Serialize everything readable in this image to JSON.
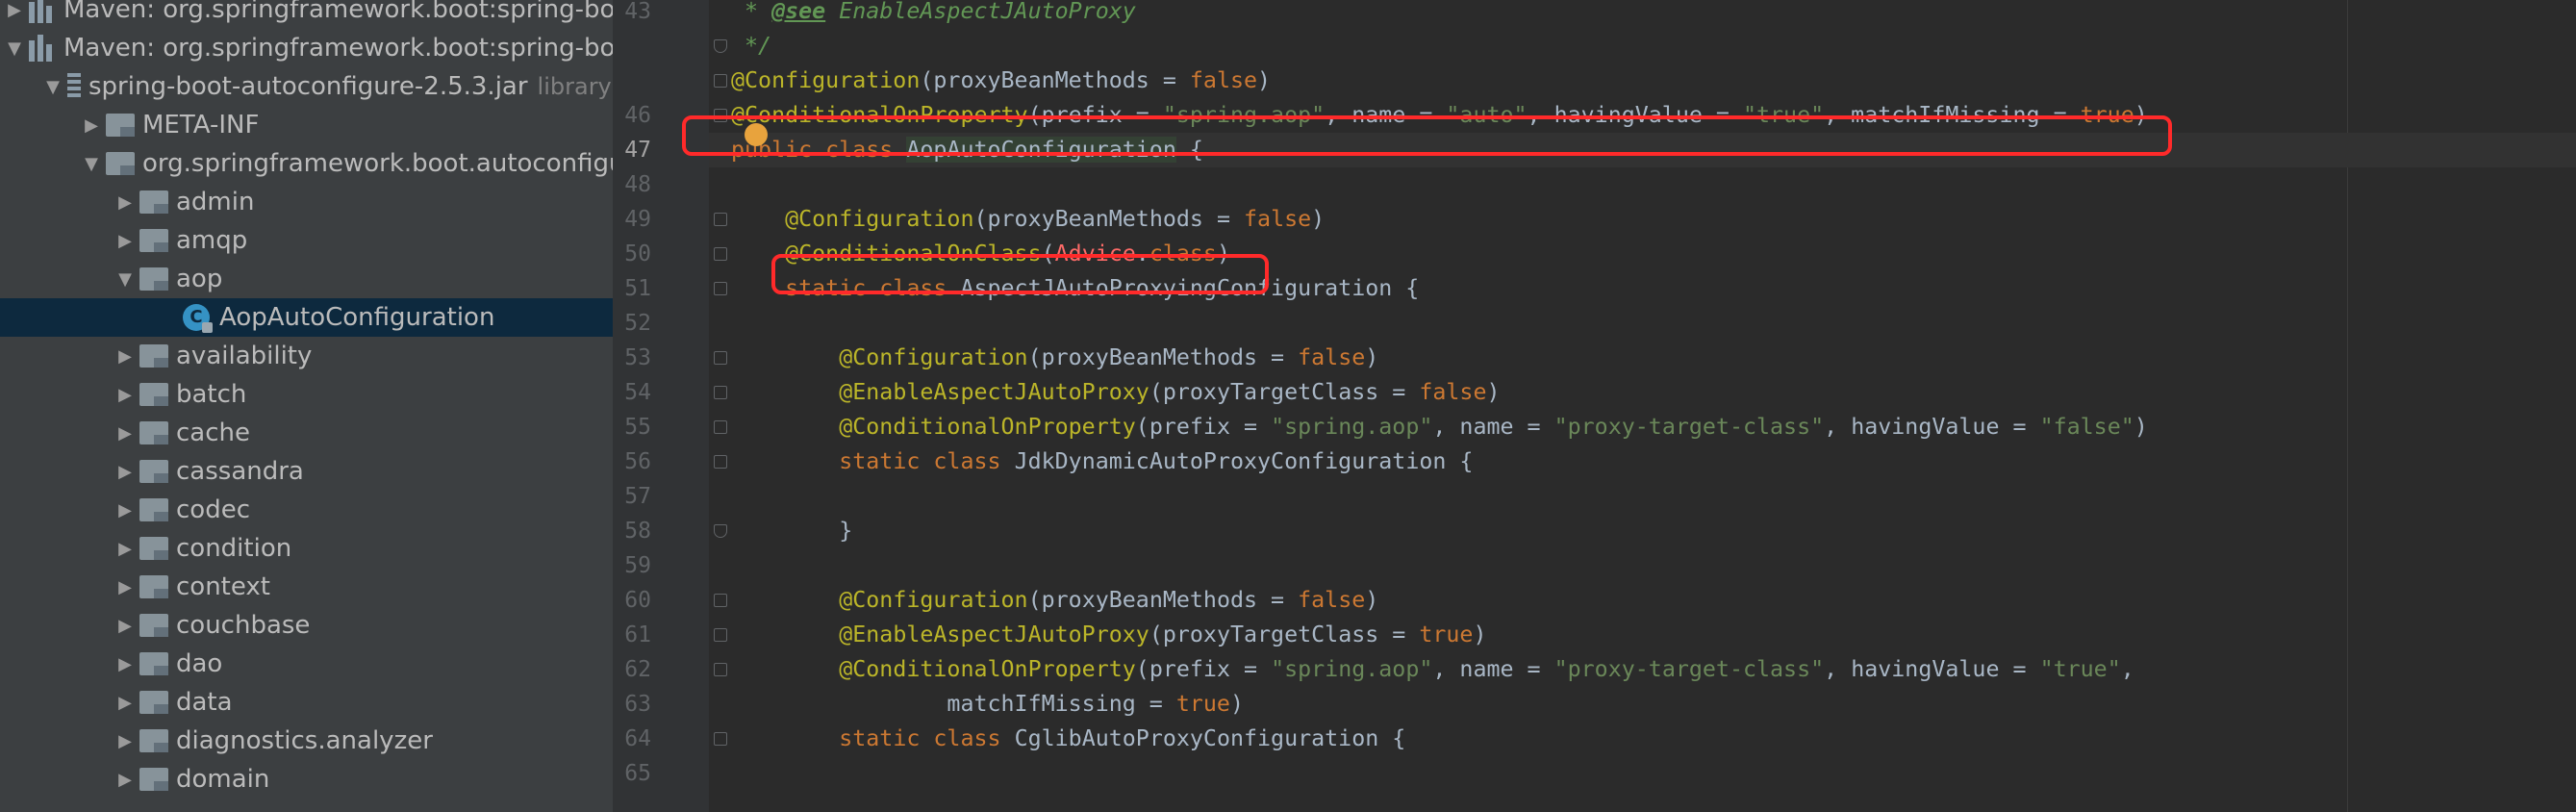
{
  "tree": {
    "rows": [
      {
        "label": "Maven: org.springframework.boot:spring-bo",
        "tag": "",
        "arrow": "▶"
      },
      {
        "label": "Maven: org.springframework.boot:spring-bo",
        "tag": "",
        "arrow": "▼"
      },
      {
        "label": "spring-boot-autoconfigure-2.5.3.jar",
        "tag": "library root",
        "arrow": "▼"
      },
      {
        "label": "META-INF",
        "tag": "",
        "arrow": "▶"
      },
      {
        "label": "org.springframework.boot.autoconfigu",
        "tag": "",
        "arrow": "▼"
      },
      {
        "label": "admin",
        "tag": "",
        "arrow": "▶"
      },
      {
        "label": "amqp",
        "tag": "",
        "arrow": "▶"
      },
      {
        "label": "aop",
        "tag": "",
        "arrow": "▼"
      },
      {
        "label": "AopAutoConfiguration",
        "tag": "",
        "arrow": ""
      },
      {
        "label": "availability",
        "tag": "",
        "arrow": "▶"
      },
      {
        "label": "batch",
        "tag": "",
        "arrow": "▶"
      },
      {
        "label": "cache",
        "tag": "",
        "arrow": "▶"
      },
      {
        "label": "cassandra",
        "tag": "",
        "arrow": "▶"
      },
      {
        "label": "codec",
        "tag": "",
        "arrow": "▶"
      },
      {
        "label": "condition",
        "tag": "",
        "arrow": "▶"
      },
      {
        "label": "context",
        "tag": "",
        "arrow": "▶"
      },
      {
        "label": "couchbase",
        "tag": "",
        "arrow": "▶"
      },
      {
        "label": "dao",
        "tag": "",
        "arrow": "▶"
      },
      {
        "label": "data",
        "tag": "",
        "arrow": "▶"
      },
      {
        "label": "diagnostics.analyzer",
        "tag": "",
        "arrow": "▶"
      },
      {
        "label": "domain",
        "tag": "",
        "arrow": "▶"
      }
    ],
    "class_icon_letter": "C"
  },
  "editor": {
    "current_line": "47",
    "lines": [
      {
        "no": "43",
        "tokens": [
          {
            "t": " * ",
            "c": "cmt"
          },
          {
            "t": "@see",
            "c": "tag"
          },
          {
            "t": " EnableAspectJAutoProxy",
            "c": "cmt"
          }
        ]
      },
      {
        "no": "",
        "tokens": [
          {
            "t": " */",
            "c": "cmt"
          }
        ]
      },
      {
        "no": "",
        "tokens": [
          {
            "t": "@Configuration",
            "c": "ann"
          },
          {
            "t": "(proxyBeanMethods = ",
            "c": "plain"
          },
          {
            "t": "false",
            "c": "kw"
          },
          {
            "t": ")",
            "c": "plain"
          }
        ]
      },
      {
        "no": "46",
        "tokens": [
          {
            "t": "@ConditionalOnProperty",
            "c": "ann"
          },
          {
            "t": "(prefix = ",
            "c": "plain"
          },
          {
            "t": "\"spring.aop\"",
            "c": "str"
          },
          {
            "t": ", name = ",
            "c": "plain"
          },
          {
            "t": "\"auto\"",
            "c": "str"
          },
          {
            "t": ", havingValue = ",
            "c": "plain"
          },
          {
            "t": "\"true\"",
            "c": "str"
          },
          {
            "t": ", matchIfMissing = ",
            "c": "plain"
          },
          {
            "t": "true",
            "c": "kw"
          },
          {
            "t": ")",
            "c": "plain"
          }
        ]
      },
      {
        "no": "47",
        "tokens": [
          {
            "t": "public class ",
            "c": "kw"
          },
          {
            "t": "AopAutoConfiguration",
            "c": "bg"
          },
          {
            "t": " {",
            "c": "plain"
          }
        ]
      },
      {
        "no": "48",
        "tokens": []
      },
      {
        "no": "49",
        "tokens": [
          {
            "t": "    ",
            "c": "plain"
          },
          {
            "t": "@Configuration",
            "c": "ann"
          },
          {
            "t": "(proxyBeanMethods = ",
            "c": "plain"
          },
          {
            "t": "false",
            "c": "kw"
          },
          {
            "t": ")",
            "c": "plain"
          }
        ]
      },
      {
        "no": "50",
        "tokens": [
          {
            "t": "    ",
            "c": "plain"
          },
          {
            "t": "@ConditionalOnClass",
            "c": "ann"
          },
          {
            "t": "(",
            "c": "plain"
          },
          {
            "t": "Advice",
            "c": "err"
          },
          {
            "t": ".",
            "c": "plain"
          },
          {
            "t": "class",
            "c": "kw"
          },
          {
            "t": ")",
            "c": "plain"
          }
        ]
      },
      {
        "no": "51",
        "tokens": [
          {
            "t": "    ",
            "c": "plain"
          },
          {
            "t": "static class ",
            "c": "kw"
          },
          {
            "t": "AspectJAutoProxyingConfiguration {",
            "c": "plain"
          }
        ]
      },
      {
        "no": "52",
        "tokens": []
      },
      {
        "no": "53",
        "tokens": [
          {
            "t": "        ",
            "c": "plain"
          },
          {
            "t": "@Configuration",
            "c": "ann"
          },
          {
            "t": "(proxyBeanMethods = ",
            "c": "plain"
          },
          {
            "t": "false",
            "c": "kw"
          },
          {
            "t": ")",
            "c": "plain"
          }
        ]
      },
      {
        "no": "54",
        "tokens": [
          {
            "t": "        ",
            "c": "plain"
          },
          {
            "t": "@EnableAspectJAutoProxy",
            "c": "ann"
          },
          {
            "t": "(proxyTargetClass = ",
            "c": "plain"
          },
          {
            "t": "false",
            "c": "kw"
          },
          {
            "t": ")",
            "c": "plain"
          }
        ]
      },
      {
        "no": "55",
        "tokens": [
          {
            "t": "        ",
            "c": "plain"
          },
          {
            "t": "@ConditionalOnProperty",
            "c": "ann"
          },
          {
            "t": "(prefix = ",
            "c": "plain"
          },
          {
            "t": "\"spring.aop\"",
            "c": "str"
          },
          {
            "t": ", name = ",
            "c": "plain"
          },
          {
            "t": "\"proxy-target-class\"",
            "c": "str"
          },
          {
            "t": ", havingValue = ",
            "c": "plain"
          },
          {
            "t": "\"false\"",
            "c": "str"
          },
          {
            "t": ")",
            "c": "plain"
          }
        ]
      },
      {
        "no": "56",
        "tokens": [
          {
            "t": "        ",
            "c": "plain"
          },
          {
            "t": "static class ",
            "c": "kw"
          },
          {
            "t": "JdkDynamicAutoProxyConfiguration {",
            "c": "plain"
          }
        ]
      },
      {
        "no": "57",
        "tokens": []
      },
      {
        "no": "58",
        "tokens": [
          {
            "t": "        }",
            "c": "plain"
          }
        ]
      },
      {
        "no": "59",
        "tokens": []
      },
      {
        "no": "60",
        "tokens": [
          {
            "t": "        ",
            "c": "plain"
          },
          {
            "t": "@Configuration",
            "c": "ann"
          },
          {
            "t": "(proxyBeanMethods = ",
            "c": "plain"
          },
          {
            "t": "false",
            "c": "kw"
          },
          {
            "t": ")",
            "c": "plain"
          }
        ]
      },
      {
        "no": "61",
        "tokens": [
          {
            "t": "        ",
            "c": "plain"
          },
          {
            "t": "@EnableAspectJAutoProxy",
            "c": "ann"
          },
          {
            "t": "(proxyTargetClass = ",
            "c": "plain"
          },
          {
            "t": "true",
            "c": "kw"
          },
          {
            "t": ")",
            "c": "plain"
          }
        ]
      },
      {
        "no": "62",
        "tokens": [
          {
            "t": "        ",
            "c": "plain"
          },
          {
            "t": "@ConditionalOnProperty",
            "c": "ann"
          },
          {
            "t": "(prefix = ",
            "c": "plain"
          },
          {
            "t": "\"spring.aop\"",
            "c": "str"
          },
          {
            "t": ", name = ",
            "c": "plain"
          },
          {
            "t": "\"proxy-target-class\"",
            "c": "str"
          },
          {
            "t": ", havingValue = ",
            "c": "plain"
          },
          {
            "t": "\"true\"",
            "c": "str"
          },
          {
            "t": ",",
            "c": "plain"
          }
        ]
      },
      {
        "no": "63",
        "tokens": [
          {
            "t": "                matchIfMissing = ",
            "c": "plain"
          },
          {
            "t": "true",
            "c": "kw"
          },
          {
            "t": ")",
            "c": "plain"
          }
        ]
      },
      {
        "no": "64",
        "tokens": [
          {
            "t": "        ",
            "c": "plain"
          },
          {
            "t": "static class ",
            "c": "kw"
          },
          {
            "t": "CglibAutoProxyConfiguration {",
            "c": "plain"
          }
        ]
      },
      {
        "no": "65",
        "tokens": []
      }
    ]
  },
  "colors": {
    "highlight_box": "#ff2a2a",
    "selection": "#0d293e",
    "annotation": "#bbb529",
    "keyword": "#cc7832",
    "string": "#6a8759",
    "error": "#ff6b68"
  }
}
